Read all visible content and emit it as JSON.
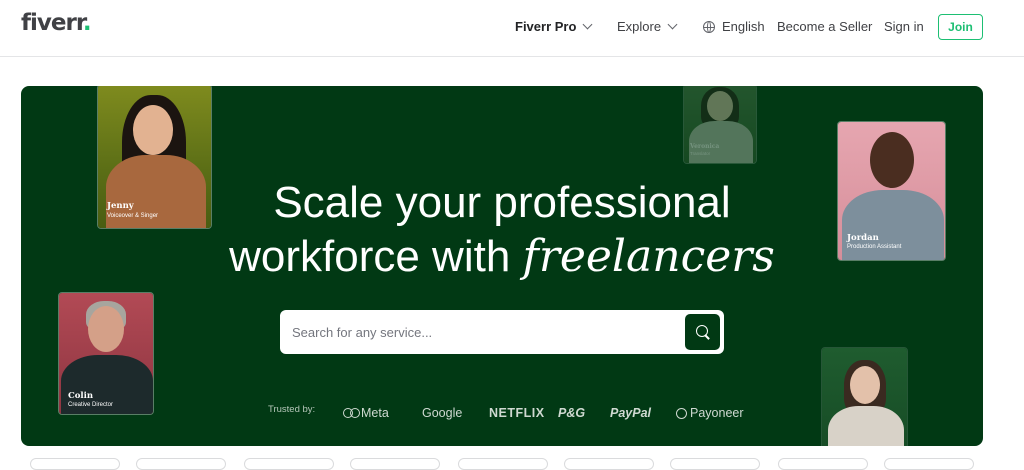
{
  "header": {
    "logo": "fiverr",
    "logo_dot": ".",
    "nav": {
      "fiverr_pro": "Fiverr Pro",
      "explore": "Explore",
      "language": "English",
      "become_seller": "Become a Seller",
      "sign_in": "Sign in",
      "join": "Join"
    }
  },
  "hero": {
    "headline_line1": "Scale your professional",
    "headline_line2_prefix": "workforce with ",
    "headline_italic": "freelancers",
    "search": {
      "placeholder": "Search for any service..."
    },
    "trusted_label": "Trusted by:",
    "brands": [
      "Meta",
      "Google",
      "NETFLIX",
      "P&G",
      "PayPal",
      "Payoneer"
    ],
    "freelancers": [
      {
        "name": "Jenny",
        "role": "Voiceover & Singer"
      },
      {
        "name": "Veronica",
        "role": "Translator"
      },
      {
        "name": "Jordan",
        "role": "Production Assistant"
      },
      {
        "name": "Colin",
        "role": "Creative Director"
      }
    ]
  },
  "colors": {
    "brand_green": "#1dbf73",
    "hero_bg": "#013914"
  }
}
